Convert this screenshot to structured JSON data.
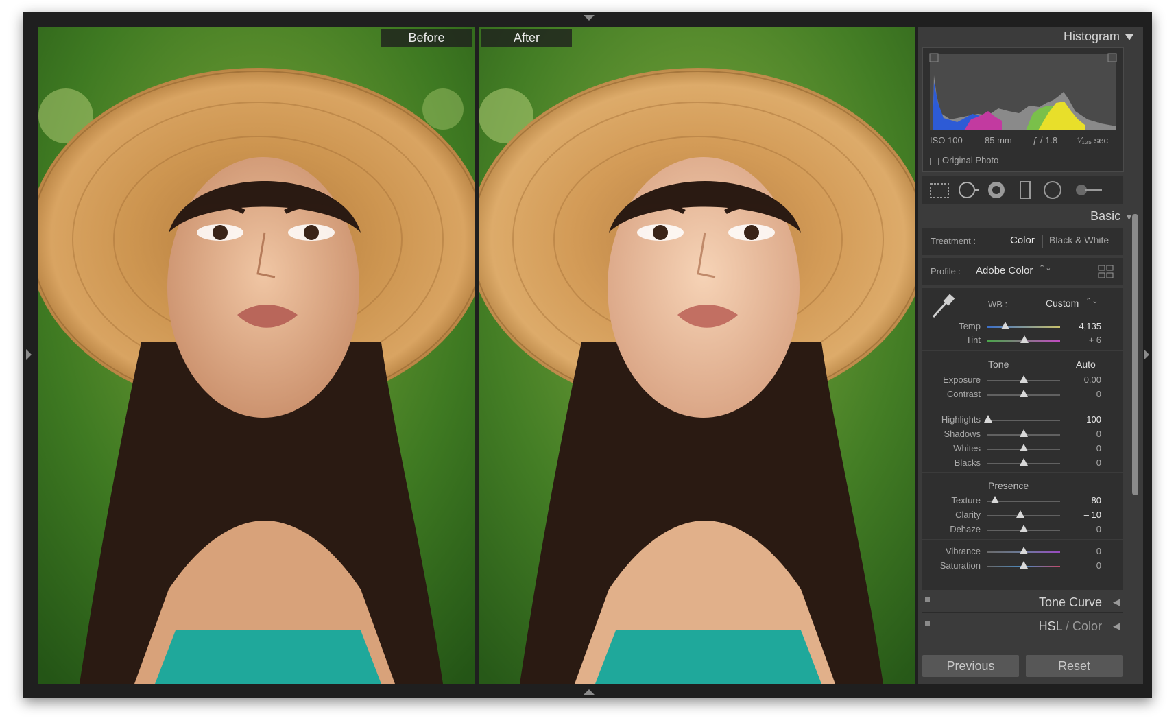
{
  "compare": {
    "before_label": "Before",
    "after_label": "After"
  },
  "histogram": {
    "title": "Histogram",
    "iso": "ISO 100",
    "focal_length": "85 mm",
    "aperture": "ƒ / 1.8",
    "shutter": "¹⁄₁₂₅ sec",
    "original_photo_label": "Original Photo",
    "original_photo_checked": false
  },
  "tools": [
    "crop-overlay",
    "spot-removal",
    "red-eye",
    "graduated-filter",
    "radial-filter",
    "adjustment-brush"
  ],
  "basic": {
    "title": "Basic",
    "treatment_label": "Treatment :",
    "treatment_options": [
      "Color",
      "Black & White"
    ],
    "treatment_selected": "Color",
    "profile_label": "Profile :",
    "profile_value": "Adobe Color",
    "wb_label": "WB :",
    "wb_value": "Custom",
    "temp": {
      "label": "Temp",
      "value": "4,135"
    },
    "tint": {
      "label": "Tint",
      "value": "+ 6"
    },
    "tone_label": "Tone",
    "auto_label": "Auto",
    "exposure": {
      "label": "Exposure",
      "value": "0.00"
    },
    "contrast": {
      "label": "Contrast",
      "value": "0"
    },
    "highlights": {
      "label": "Highlights",
      "value": "– 100"
    },
    "shadows": {
      "label": "Shadows",
      "value": "0"
    },
    "whites": {
      "label": "Whites",
      "value": "0"
    },
    "blacks": {
      "label": "Blacks",
      "value": "0"
    },
    "presence_label": "Presence",
    "texture": {
      "label": "Texture",
      "value": "– 80"
    },
    "clarity": {
      "label": "Clarity",
      "value": "– 10"
    },
    "dehaze": {
      "label": "Dehaze",
      "value": "0"
    },
    "vibrance": {
      "label": "Vibrance",
      "value": "0"
    },
    "saturation": {
      "label": "Saturation",
      "value": "0"
    }
  },
  "collapsed_panels": {
    "tone_curve": "Tone Curve",
    "hsl": "HSL",
    "color": "Color"
  },
  "buttons": {
    "previous": "Previous",
    "reset": "Reset"
  },
  "colors": {
    "panel_bg": "#3b3b3b",
    "box_bg": "#2f2f2f",
    "window_bg": "#1f1f1f"
  }
}
